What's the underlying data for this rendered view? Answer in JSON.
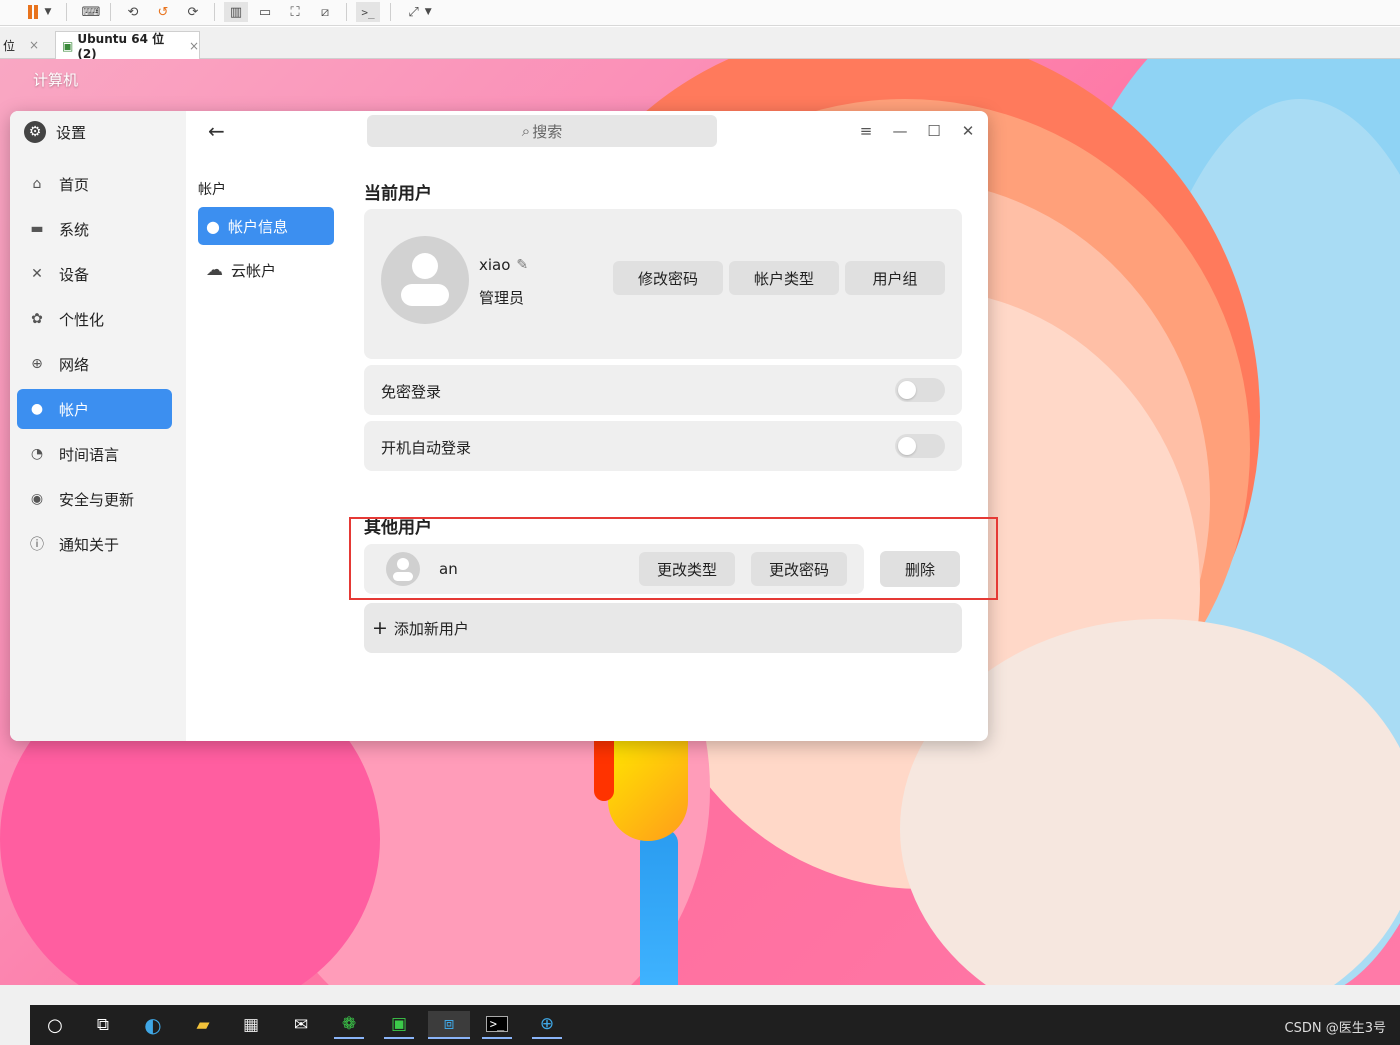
{
  "vm": {
    "tabs": [
      {
        "label": "位"
      },
      {
        "label": "Ubuntu 64 位 (2)"
      }
    ],
    "tab_close_glyph": "×",
    "toolbar_icons": [
      "pause-icon",
      "send-keys-icon",
      "snapshot-icon",
      "revert-snapshot-icon",
      "manage-snapshots-icon",
      "library-view-icon",
      "console-view-icon",
      "fullscreen-icon",
      "unity-icon",
      "terminal-icon",
      "stretch-icon"
    ]
  },
  "desktop": {
    "label": "计算机"
  },
  "settings": {
    "app_title": "设置",
    "nav_items": [
      {
        "label": "首页",
        "icon": "home-icon"
      },
      {
        "label": "系统",
        "icon": "monitor-icon"
      },
      {
        "label": "设备",
        "icon": "device-icon"
      },
      {
        "label": "个性化",
        "icon": "palette-icon"
      },
      {
        "label": "网络",
        "icon": "globe-icon"
      },
      {
        "label": "帐户",
        "icon": "user-icon",
        "active": true
      },
      {
        "label": "时间语言",
        "icon": "clock-icon"
      },
      {
        "label": "安全与更新",
        "icon": "shield-icon"
      },
      {
        "label": "通知关于",
        "icon": "info-icon"
      }
    ],
    "sub_title": "帐户",
    "sub_items": [
      {
        "label": "帐户信息",
        "icon": "user-icon",
        "active": true
      },
      {
        "label": "云帐户",
        "icon": "cloud-icon"
      }
    ],
    "search_placeholder": "搜索",
    "current_user": {
      "section_title": "当前用户",
      "name": "xiao",
      "role": "管理员",
      "buttons": [
        "修改密码",
        "帐户类型",
        "用户组"
      ]
    },
    "toggles": [
      {
        "label": "免密登录",
        "on": false
      },
      {
        "label": "开机自动登录",
        "on": false
      }
    ],
    "other_users": {
      "section_title": "其他用户",
      "users": [
        {
          "name": "an",
          "buttons": [
            "更改类型",
            "更改密码"
          ],
          "delete_label": "删除"
        }
      ],
      "add_label": "添加新用户"
    }
  },
  "taskbar": {
    "tray_text": "CSDN @医生3号"
  },
  "colors": {
    "accent": "#3c8ff0",
    "highlight": "#e53935",
    "card": "#efefef"
  }
}
